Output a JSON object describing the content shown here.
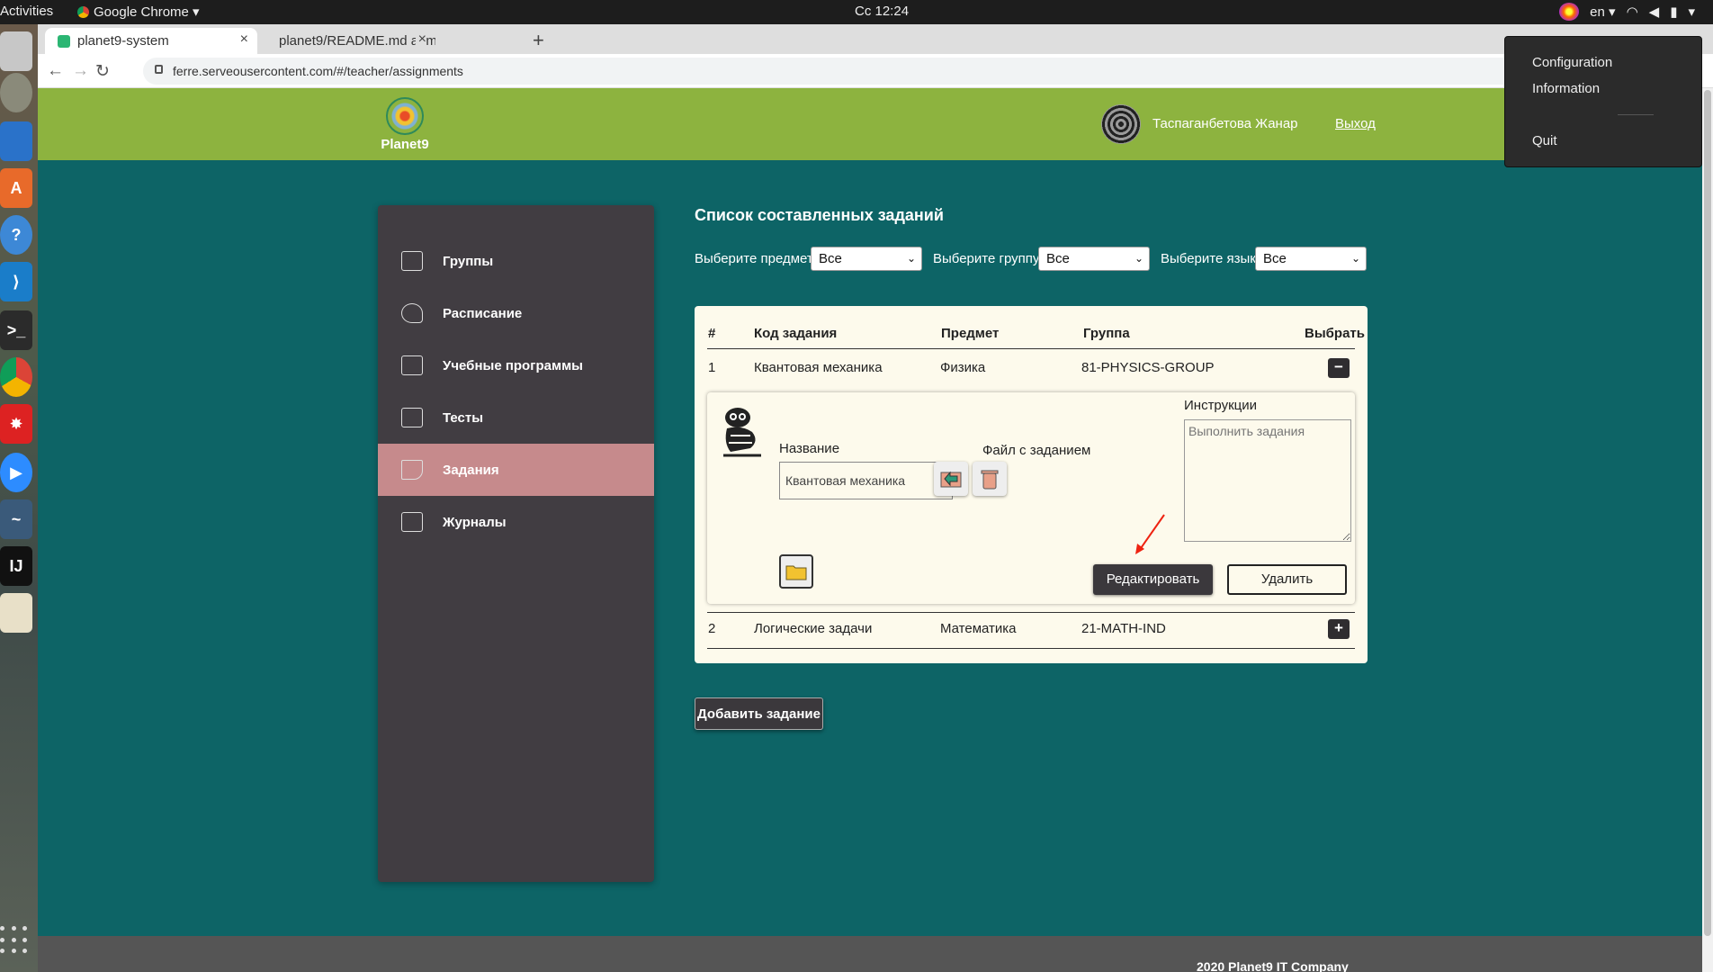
{
  "os": {
    "activities": "Activities",
    "app_menu": "Google Chrome",
    "clock": "Сс 12:24",
    "language": "en"
  },
  "browser": {
    "tabs": [
      {
        "title": "planet9-system",
        "active": true
      },
      {
        "title": "planet9/README.md at m",
        "active": false
      }
    ],
    "url": "ferre.serveousercontent.com/#/teacher/assignments"
  },
  "header": {
    "logo": "Planet9",
    "user_name": "Таспаганбетова Жанар",
    "logout": "Выход"
  },
  "sidebar": {
    "items": [
      {
        "label": "Группы",
        "icon": "groups-icon",
        "active": false
      },
      {
        "label": "Расписание",
        "icon": "bell-icon",
        "active": false
      },
      {
        "label": "Учебные программы",
        "icon": "program-icon",
        "active": false
      },
      {
        "label": "Тесты",
        "icon": "tests-icon",
        "active": false
      },
      {
        "label": "Задания",
        "icon": "pen-icon",
        "active": true
      },
      {
        "label": "Журналы",
        "icon": "journal-icon",
        "active": false
      }
    ]
  },
  "main": {
    "title": "Список составленных заданий",
    "filters": {
      "subject_label": "Выберите предмет:",
      "subject_value": "Все",
      "group_label": "Выберите группу:",
      "group_value": "Все",
      "lang_label": "Выберите язык:",
      "lang_value": "Все"
    },
    "table": {
      "headers": [
        "#",
        "Код задания",
        "Предмет",
        "Группа",
        "Выбрать"
      ],
      "rows": [
        {
          "num": "1",
          "code": "Квантовая механика",
          "subject": "Физика",
          "group": "81-PHYSICS-GROUP",
          "toggle": "−"
        },
        {
          "num": "2",
          "code": "Логические задачи",
          "subject": "Математика",
          "group": "21-MATH-IND",
          "toggle": "+"
        }
      ]
    },
    "detail": {
      "name_label": "Название",
      "name_value": "Квантовая механика",
      "file_label": "Файл с заданием",
      "instructions_label": "Инструкции",
      "instructions_placeholder": "Выполнить задания",
      "edit_button": "Редактировать",
      "delete_button": "Удалить"
    },
    "add_button": "Добавить задание"
  },
  "footer": {
    "copyright": "2020 Planet9 IT Company"
  },
  "tray_menu": {
    "items": [
      "Configuration",
      "Information",
      "Quit"
    ]
  },
  "colors": {
    "page_bg": "#0d6466",
    "header_bg": "#8db33f",
    "sidebar_bg": "#413d42",
    "sidebar_active": "#c68a8c",
    "card_bg": "#fdfaec"
  }
}
